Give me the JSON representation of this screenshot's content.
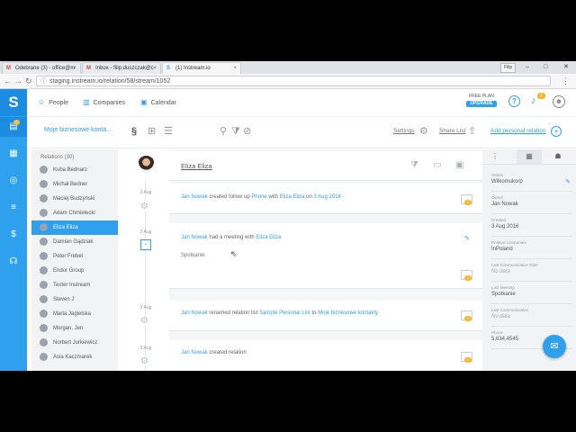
{
  "browser": {
    "tabs": [
      {
        "label": "Odebrane (3) - office@m",
        "icon": "gmail-icon"
      },
      {
        "label": "Inbox - filip.duszczak@c",
        "icon": "gmail-icon"
      },
      {
        "label": "(1) Instream.io",
        "icon": "instream-icon"
      }
    ],
    "profile_label": "Filip",
    "url": "staging.instream.io/relation/58/stream/1052"
  },
  "topnav": {
    "people": "People",
    "companies": "Companies",
    "calendar": "Calendar",
    "free_plan": "FREE PLAN",
    "upgrade": "UPGRADE",
    "notification_count": "1"
  },
  "leftnav": {
    "badge": "1"
  },
  "subbar": {
    "list_name": "Moje biznesowe konta...",
    "settings": "Settings",
    "share_list": "Share List",
    "add_relation": "Add personal relation"
  },
  "relations": {
    "header": "Relations (30)",
    "items": [
      "Kuba Bednarz",
      "Michał Bedner",
      "Maciej Budzyński",
      "Adam Chmielecki",
      "Eliza Eliza",
      "Damian Gądziak",
      "Peter Frebel",
      "Endor Group",
      "Tester Instream",
      "Steven J",
      "Marta Jagielska",
      "Morgan, Jen",
      "Norbert Jurkiewicz",
      "Asia Kaczmarek"
    ],
    "active_index": 4
  },
  "timeline": {
    "dates": [
      "3 Aug",
      "3 Aug",
      "3 Aug",
      "3 Aug"
    ]
  },
  "stream": {
    "contact_name": "Eliza Eliza",
    "entries": [
      {
        "actor": "Jan Nowak",
        "text1": "created follow up",
        "link1": "Phone",
        "text2": "with",
        "link2": "Eliza Eliza",
        "text3": "on",
        "link3": "3 Aug 2016",
        "badge": "1"
      },
      {
        "actor": "Jan Nowak",
        "text1": "had a meeting with",
        "link1": "Eliza Eliza",
        "note": "Spotkanie",
        "badge": "1"
      },
      {
        "actor": "Jan Nowak",
        "text1": "renamed relation list",
        "link1": "Sample Personal List",
        "text2": "to",
        "link2": "Moje biznesowe kontakty",
        "badge": "1"
      },
      {
        "actor": "Jan Nowak",
        "text1": "created relation",
        "badge": "1"
      }
    ]
  },
  "details": {
    "fields": [
      {
        "label": "Status",
        "value": "Wilkomukorp",
        "editable": true
      },
      {
        "label": "Owner",
        "value": "Jan Nowak"
      },
      {
        "label": "Created",
        "value": "3 Aug 2016"
      },
      {
        "label": "Related companies",
        "value": "InPoland"
      },
      {
        "label": "Last Communication Date",
        "value": "No data",
        "empty": true
      },
      {
        "label": "Last Meeting",
        "value": "Spotkanie"
      },
      {
        "label": "Last Communication",
        "value": "No data",
        "empty": true
      },
      {
        "label": "Phone",
        "value": "5,634,4545"
      }
    ]
  },
  "colors": {
    "accent": "#2fa0ee",
    "badge": "#f5b82e"
  }
}
